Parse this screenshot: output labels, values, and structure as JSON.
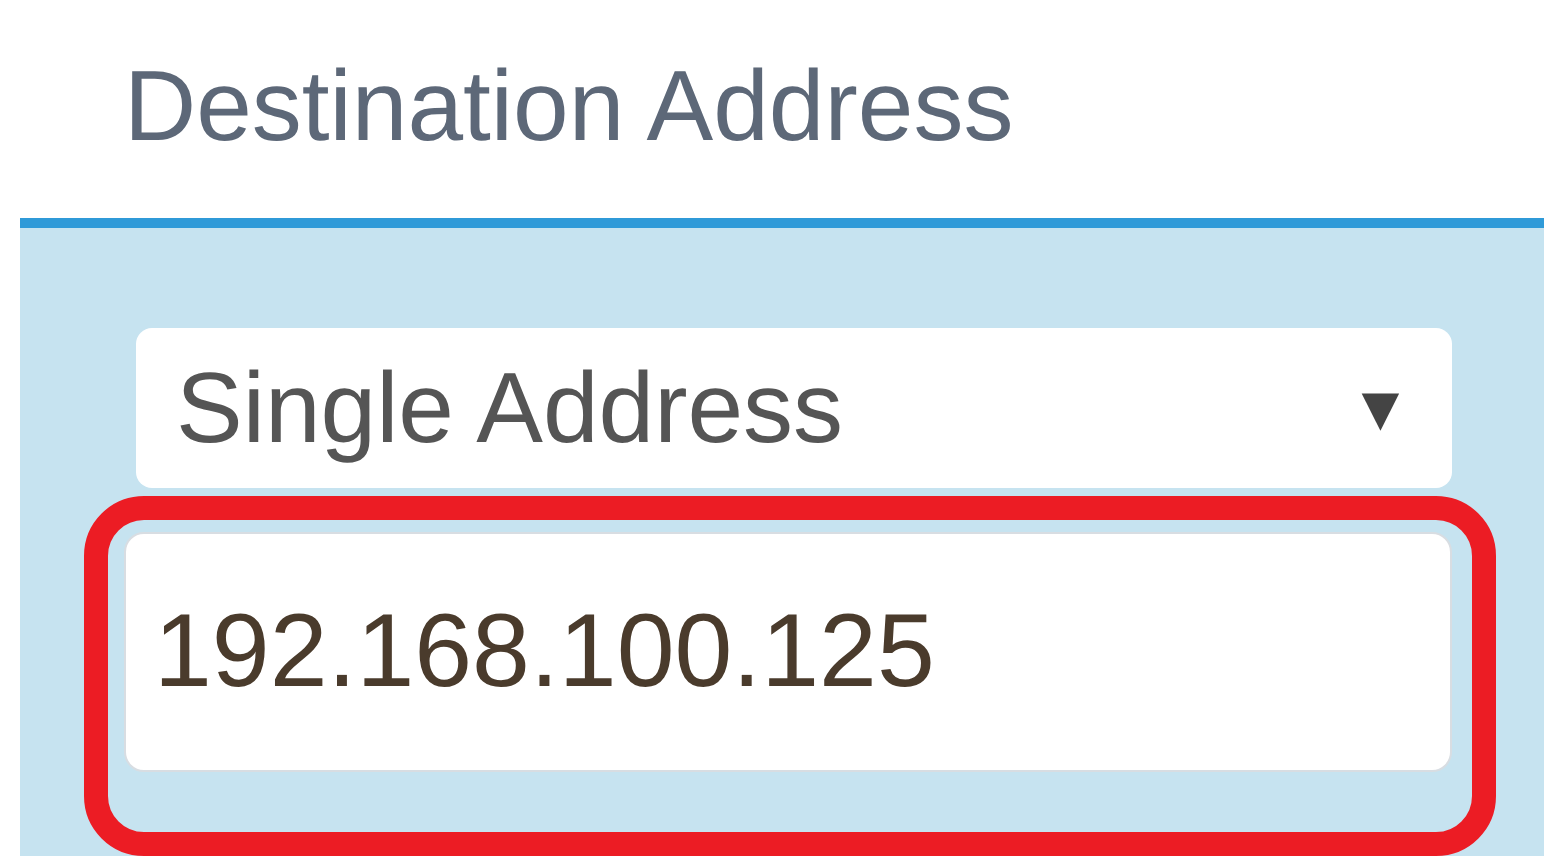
{
  "heading": "Destination Address",
  "address_type": {
    "value": "Single Address",
    "caret": "▼"
  },
  "address_field": {
    "value": "192.168.100.125",
    "highlighted": true
  }
}
